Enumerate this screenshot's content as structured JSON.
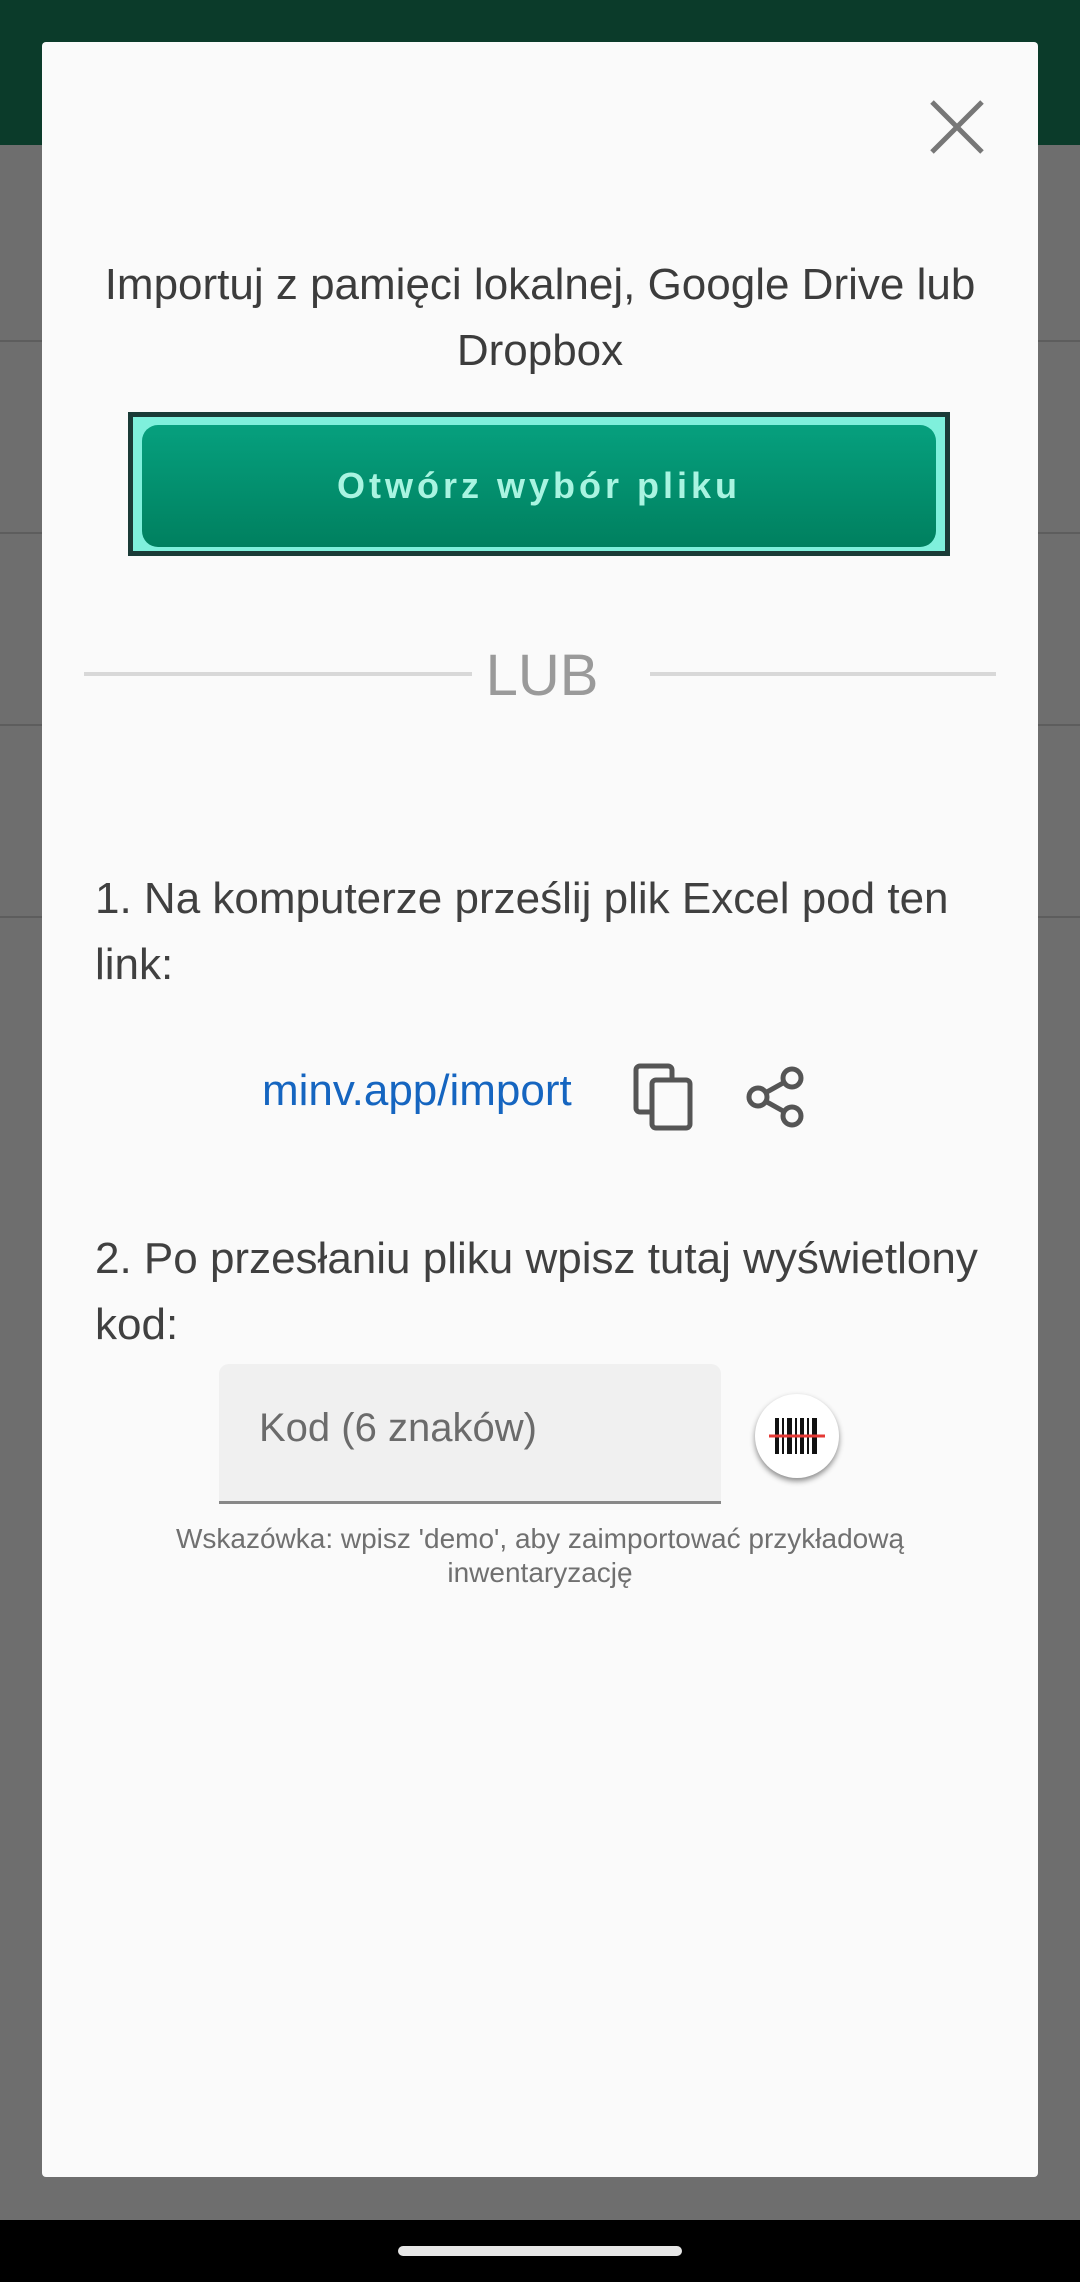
{
  "dialog": {
    "title": "Importuj z pamięci lokalnej, Google Drive lub Dropbox",
    "open_button_label": "Otwórz wybór pliku",
    "divider_label": "LUB",
    "step1_text": "1. Na komputerze prześlij plik Excel pod ten link:",
    "link_text": "minv.app/import",
    "step2_text": "2. Po przesłaniu pliku wpisz tutaj wyświetlony kod:",
    "code_placeholder": "Kod (6 znaków)",
    "hint_text": "Wskazówka: wpisz 'demo', aby zaimportować przykładową inwentaryzację"
  },
  "icons": {
    "close": "close-icon",
    "copy": "copy-icon",
    "share": "share-icon",
    "barcode": "barcode-scan-icon"
  },
  "colors": {
    "button_green": "#00805f",
    "link_blue": "#1565c0",
    "status_bar": "#0b3b2a"
  }
}
